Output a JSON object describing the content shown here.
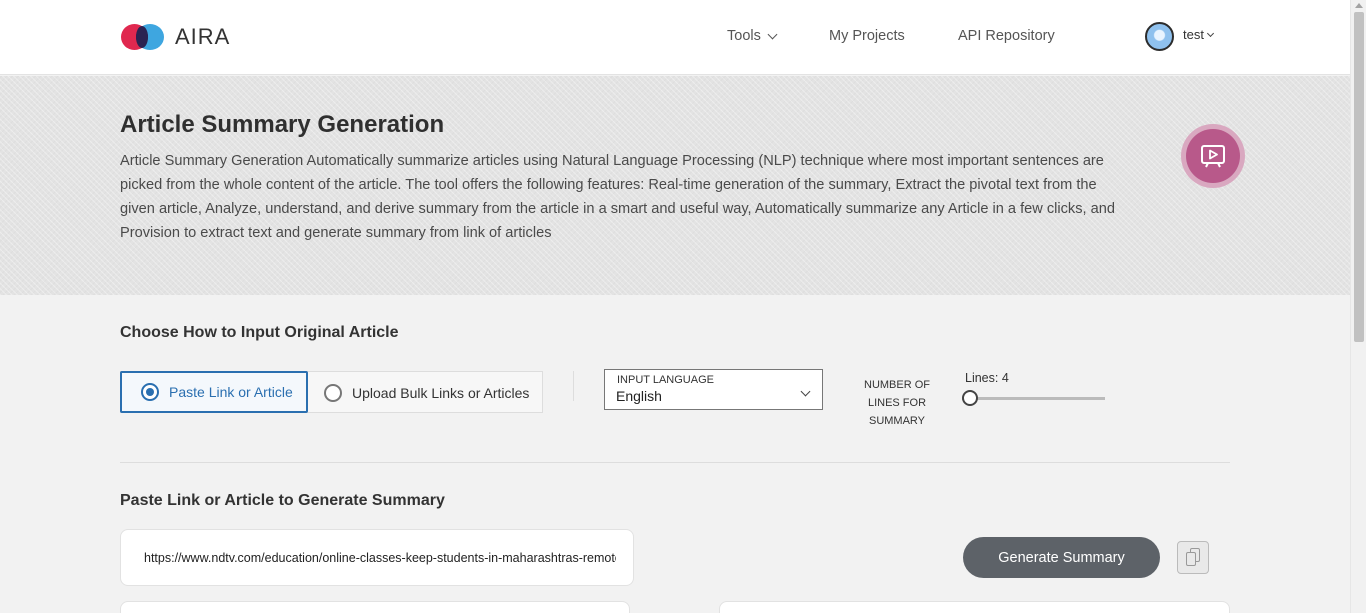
{
  "app": {
    "logo_text": "AIRA"
  },
  "nav": {
    "tools": "Tools",
    "my_projects": "My Projects",
    "api_repository": "API Repository",
    "user_name": "test"
  },
  "hero": {
    "title": "Article Summary Generation",
    "description": "Article Summary Generation Automatically summarize articles using Natural Language Processing (NLP) technique where most important sentences are picked from the whole content of the article. The tool offers the following features: Real-time generation of the summary, Extract the pivotal text from the given article, Analyze, understand, and derive summary from the article in a smart and useful way, Automatically summarize any Article in a few clicks, and Provision to extract text and generate summary from link of articles"
  },
  "input": {
    "section_title": "Choose How to Input Original Article",
    "options": [
      {
        "label": "Paste Link or Article",
        "selected": true
      },
      {
        "label": "Upload Bulk Links or Articles",
        "selected": false
      }
    ],
    "language": {
      "label": "INPUT LANGUAGE",
      "value": "English"
    },
    "lines": {
      "label": "NUMBER OF LINES FOR SUMMARY",
      "value_text": "Lines: 4",
      "slider_fraction": 0.0
    }
  },
  "paste": {
    "section_title": "Paste Link or Article to Generate Summary",
    "url_value": "https://www.ndtv.com/education/online-classes-keep-students-in-maharashtras-remote-areas-hooked-to-studies",
    "generate_label": "Generate Summary"
  },
  "colors": {
    "accent": "#2a6fb0",
    "button_dark": "#5d6268",
    "video_btn": "#b8598a",
    "logo_red": "#e0284f",
    "logo_blue": "#3ea6e0"
  },
  "icons": {
    "logo": "aira-logo-icon",
    "tools_chevron": "chevron-down-icon",
    "avatar": "user-avatar",
    "user_chevron": "chevron-down-icon",
    "video": "video-play-icon",
    "language_chevron": "chevron-down-icon",
    "copy": "copy-icon"
  }
}
